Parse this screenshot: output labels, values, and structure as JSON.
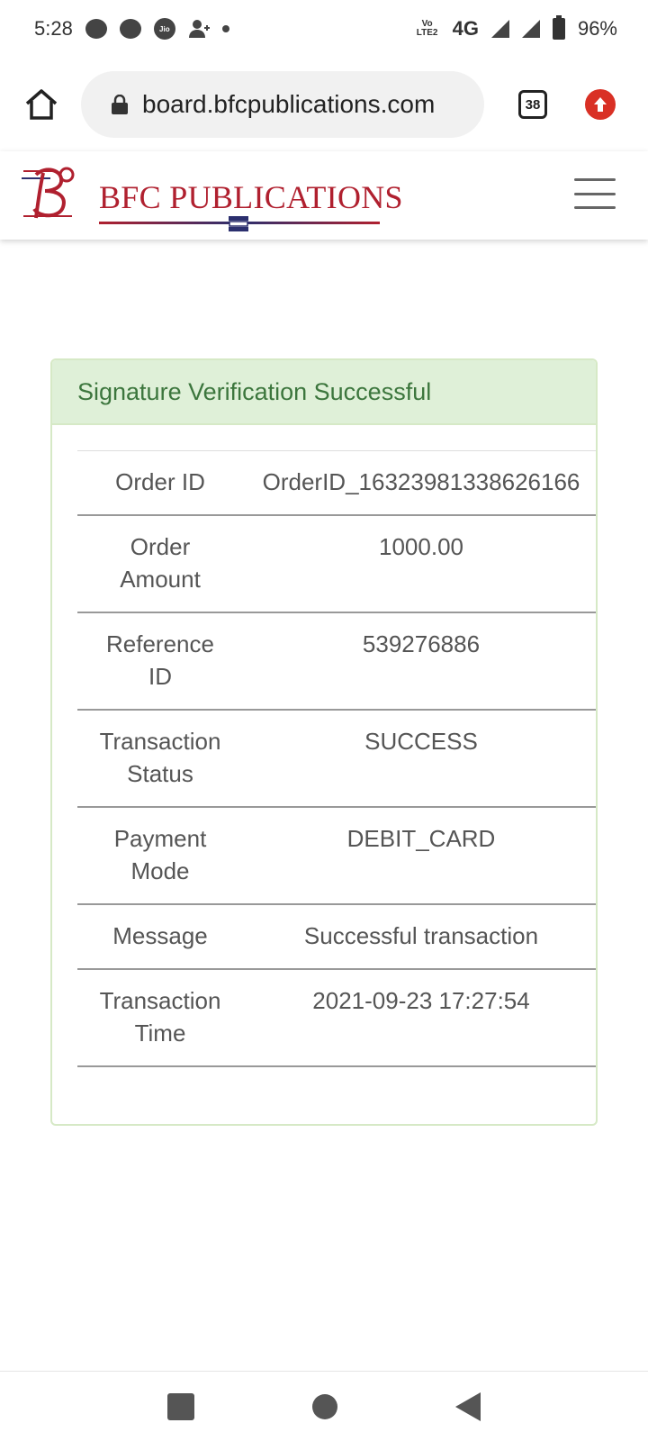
{
  "status_bar": {
    "time": "5:28",
    "network": "4G",
    "volte": "Vo LTE2",
    "battery": "96%",
    "icons": [
      "chat-icon",
      "message-icon",
      "jio-icon",
      "add-person-icon",
      "dot-icon",
      "signal-icon",
      "battery-icon"
    ]
  },
  "browser": {
    "url": "board.bfcpublications.com",
    "tab_count": "38",
    "icons": [
      "home-icon",
      "lock-icon",
      "tabs-icon",
      "update-icon"
    ],
    "update_color": "#d93025"
  },
  "site": {
    "brand_name": "BFC PUBLICATIONS",
    "brand_color": "#b0202f",
    "menu_icon": "hamburger-menu-icon"
  },
  "card": {
    "heading": "Signature Verification Successful",
    "heading_color": "#3c763d",
    "heading_bg": "#dff0d8",
    "rows": [
      {
        "label": "Order ID",
        "value": "OrderID_16323981338626166"
      },
      {
        "label": "Order Amount",
        "value": "1000.00"
      },
      {
        "label": "Reference ID",
        "value": "539276886"
      },
      {
        "label": "Transaction Status",
        "value": "SUCCESS"
      },
      {
        "label": "Payment Mode",
        "value": "DEBIT_CARD"
      },
      {
        "label": "Message",
        "value": "Successful transaction"
      },
      {
        "label": "Transaction Time",
        "value": "2021-09-23 17:27:54"
      }
    ]
  },
  "nav": {
    "icons": [
      "recent-apps-icon",
      "home-circle-icon",
      "back-icon"
    ]
  }
}
